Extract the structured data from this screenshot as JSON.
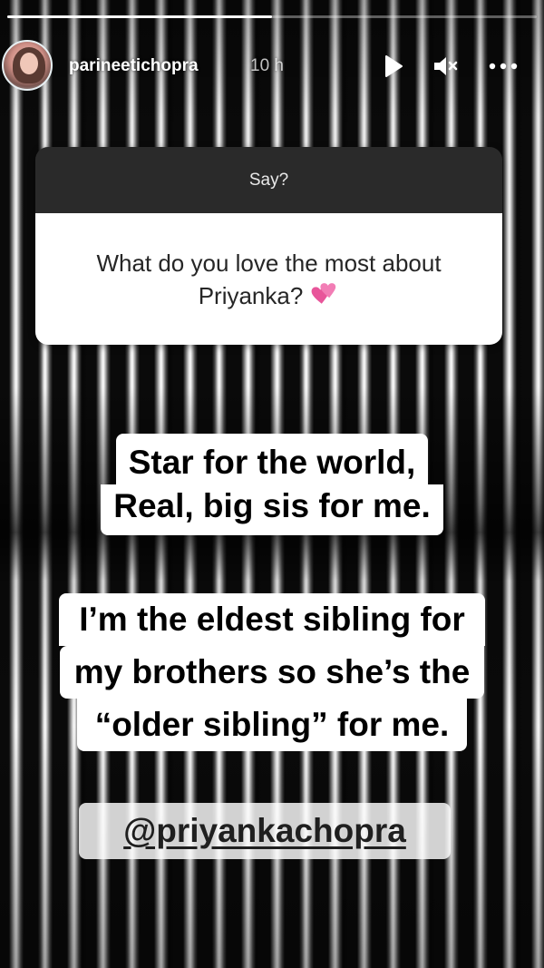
{
  "progress": {
    "segments": 1,
    "fraction": 0.5
  },
  "header": {
    "username": "parineetichopra",
    "time": "10 h",
    "icons": [
      "play-icon",
      "mute-icon",
      "more-icon"
    ]
  },
  "question": {
    "prompt": "Say?",
    "text_line1": "What do you love the most about",
    "text_line2": "Priyanka?",
    "emoji": "two-hearts-icon"
  },
  "answer": {
    "lines1": [
      "Star for the world,",
      "Real, big sis for me."
    ],
    "lines2": [
      "I’m the eldest sibling for",
      "my brothers so she’s the",
      "“older sibling” for me."
    ]
  },
  "mention": "@priyankachopra",
  "colors": {
    "sticker_bg": "#ffffff",
    "question_header_bg": "#2a2a2a",
    "heart": "#e8559a"
  }
}
